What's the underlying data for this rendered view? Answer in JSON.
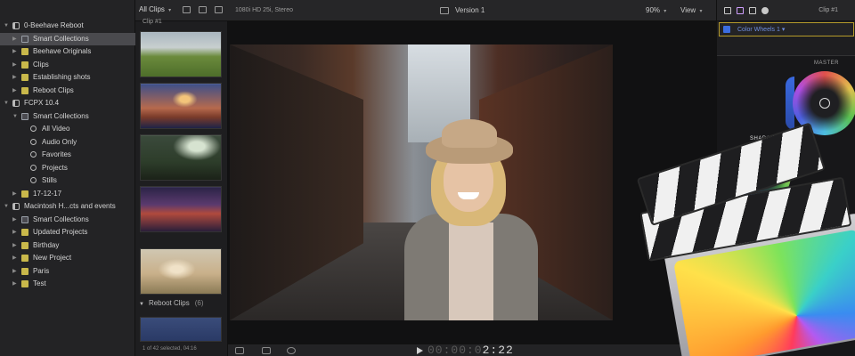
{
  "sidebar": {
    "items": [
      {
        "label": "0-Beehave Reboot",
        "icon": "library-icon",
        "level": 0,
        "disclosure": "expanded",
        "selected": false
      },
      {
        "label": "Smart Collections",
        "icon": "folder-icon",
        "level": 1,
        "disclosure": "collapsed",
        "selected": true
      },
      {
        "label": "Beehave Originals",
        "icon": "event-icon",
        "level": 1,
        "disclosure": "collapsed",
        "selected": false
      },
      {
        "label": "Clips",
        "icon": "event-icon",
        "level": 1,
        "disclosure": "collapsed",
        "selected": false
      },
      {
        "label": "Establishing shots",
        "icon": "event-icon",
        "level": 1,
        "disclosure": "collapsed",
        "selected": false
      },
      {
        "label": "Reboot Clips",
        "icon": "event-icon",
        "level": 1,
        "disclosure": "collapsed",
        "selected": false
      },
      {
        "label": "FCPX 10.4",
        "icon": "library-icon",
        "level": 0,
        "disclosure": "expanded",
        "selected": false
      },
      {
        "label": "Smart Collections",
        "icon": "folder-icon",
        "level": 1,
        "disclosure": "expanded",
        "selected": false
      },
      {
        "label": "All Video",
        "icon": "smart-collection-icon",
        "level": 2,
        "disclosure": "none",
        "selected": false
      },
      {
        "label": "Audio Only",
        "icon": "smart-collection-icon",
        "level": 2,
        "disclosure": "none",
        "selected": false
      },
      {
        "label": "Favorites",
        "icon": "smart-collection-icon",
        "level": 2,
        "disclosure": "none",
        "selected": false
      },
      {
        "label": "Projects",
        "icon": "smart-collection-icon",
        "level": 2,
        "disclosure": "none",
        "selected": false
      },
      {
        "label": "Stills",
        "icon": "smart-collection-icon",
        "level": 2,
        "disclosure": "none",
        "selected": false
      },
      {
        "label": "17-12-17",
        "icon": "event-icon",
        "level": 1,
        "disclosure": "collapsed",
        "selected": false
      },
      {
        "label": "Macintosh H...cts and events",
        "icon": "library-icon",
        "level": 0,
        "disclosure": "expanded",
        "selected": false
      },
      {
        "label": "Smart Collections",
        "icon": "folder-icon",
        "level": 1,
        "disclosure": "collapsed",
        "selected": false
      },
      {
        "label": "Updated Projects",
        "icon": "event-icon",
        "level": 1,
        "disclosure": "collapsed",
        "selected": false
      },
      {
        "label": "Birthday",
        "icon": "event-icon",
        "level": 1,
        "disclosure": "collapsed",
        "selected": false
      },
      {
        "label": "New Project",
        "icon": "event-icon",
        "level": 1,
        "disclosure": "collapsed",
        "selected": false
      },
      {
        "label": "Paris",
        "icon": "event-icon",
        "level": 1,
        "disclosure": "collapsed",
        "selected": false
      },
      {
        "label": "Test",
        "icon": "event-icon",
        "level": 1,
        "disclosure": "collapsed",
        "selected": false
      }
    ]
  },
  "browser": {
    "filter_label": "All Clips",
    "clip_caption": "Clip #1",
    "section_title": "Reboot Clips",
    "section_count": "(6)",
    "status": "1 of 42 selected, 04:16"
  },
  "viewer": {
    "format_label": "1080i HD 25i, Stereo",
    "version_label": "Version 1",
    "zoom_label": "90%",
    "view_menu_label": "View",
    "timecode_dim": "00:00:0",
    "timecode_bright": "2:22"
  },
  "inspector": {
    "clip_name": "Clip #1",
    "effect_label": "Color Wheels 1",
    "master_label": "MASTER",
    "shadows_label": "SHADOWS"
  },
  "colors": {
    "selection": "#4a4a4e",
    "accent_blue": "#3b6de0",
    "event_yellow": "#c9b84b",
    "highlight_gold": "#b59a2a"
  }
}
